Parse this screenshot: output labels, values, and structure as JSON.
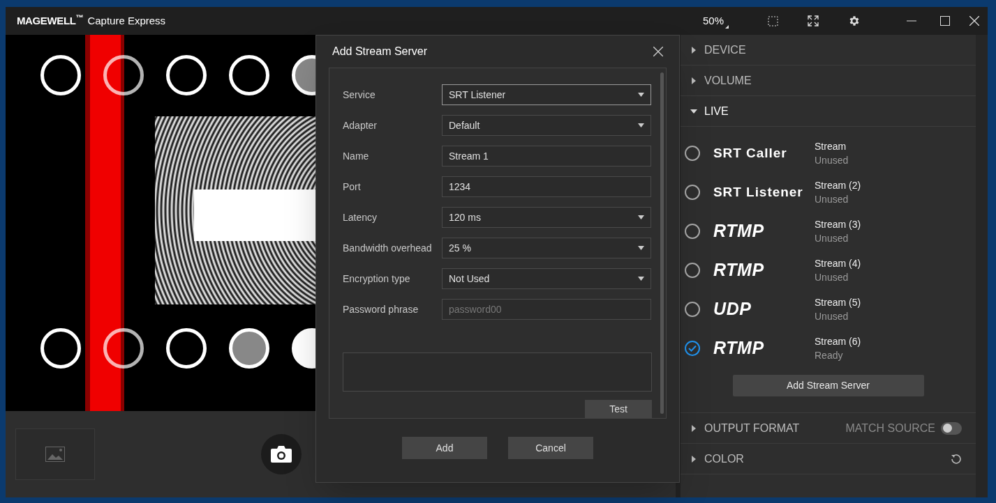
{
  "window": {
    "logo": "MAGEWELL$^{™}$",
    "title": "Capture Express",
    "zoom": "50%"
  },
  "dialog": {
    "title": "Add Stream Server",
    "fields": [
      {
        "label": "Service",
        "kind": "select",
        "value": "SRT Listener",
        "focused": true
      },
      {
        "label": "Adapter",
        "kind": "select",
        "value": "Default",
        "focused": false
      },
      {
        "label": "Name",
        "kind": "text",
        "value": "Stream 1",
        "focused": false
      },
      {
        "label": "Port",
        "kind": "text",
        "value": "1234",
        "focused": false
      },
      {
        "label": "Latency",
        "kind": "select",
        "value": "120 ms",
        "focused": false
      },
      {
        "label": "Bandwidth overhead",
        "kind": "select",
        "value": "25 %",
        "focused": false
      },
      {
        "label": "Encryption type",
        "kind": "select",
        "value": "Not Used",
        "focused": false
      },
      {
        "label": "Password phrase",
        "kind": "text",
        "placeholder": "password00",
        "focused": false
      }
    ],
    "test_button": "Test",
    "buttons": [
      "Add",
      "Cancel"
    ]
  },
  "sections_top": [
    {
      "label": "DEVICE",
      "expanded": false
    },
    {
      "label": "VOLUME",
      "expanded": false
    },
    {
      "label": "LIVE",
      "expanded": true
    }
  ],
  "servers": [
    {
      "protocol": "SRT Caller",
      "italic": false,
      "name": "Stream",
      "status": "Unused",
      "selected": false
    },
    {
      "protocol": "SRT Listener",
      "italic": false,
      "name": "Stream (2)",
      "status": "Unused",
      "selected": false
    },
    {
      "protocol": "RTMP",
      "italic": true,
      "name": "Stream (3)",
      "status": "Unused",
      "selected": false
    },
    {
      "protocol": "RTMP",
      "italic": true,
      "name": "Stream (4)",
      "status": "Unused",
      "selected": false
    },
    {
      "protocol": "UDP",
      "italic": true,
      "name": "Stream (5)",
      "status": "Unused",
      "selected": false
    },
    {
      "protocol": "RTMP",
      "italic": true,
      "name": "Stream (6)",
      "status": "Ready",
      "selected": true
    }
  ],
  "add_server_button": "Add Stream Server",
  "sections_bottom": [
    {
      "label": "OUTPUT FORMAT",
      "expanded": false,
      "kind": "toggle",
      "toggle_label": "MATCH SOURCE",
      "on": false
    },
    {
      "label": "COLOR",
      "expanded": false,
      "kind": "reset"
    }
  ]
}
